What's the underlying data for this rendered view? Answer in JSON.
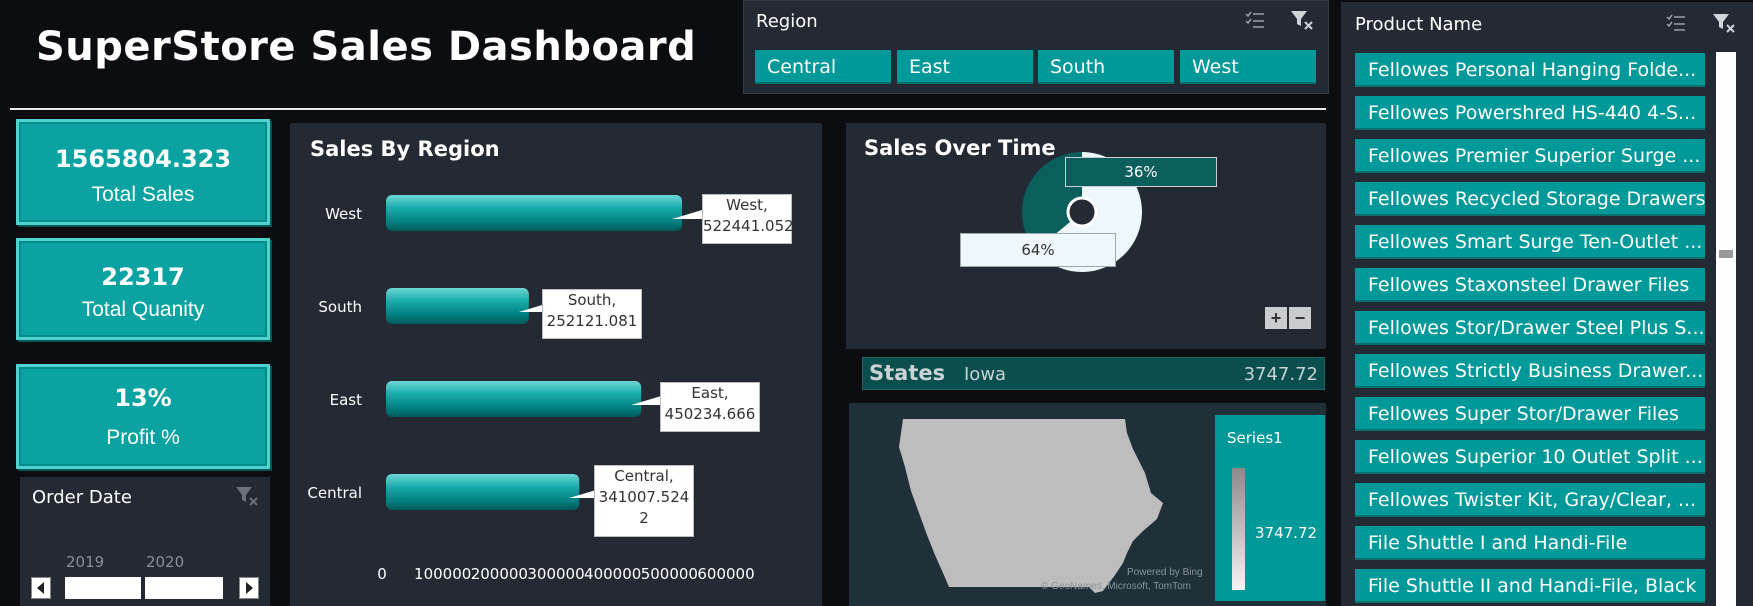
{
  "header": {
    "title": "SuperStore Sales Dashboard"
  },
  "region_slicer": {
    "title": "Region",
    "items": [
      "Central",
      "East",
      "South",
      "West"
    ]
  },
  "product_slicer": {
    "title": "Product Name",
    "items": [
      "Fellowes Personal Hanging Folde...",
      "Fellowes Powershred HS-440 4-S...",
      "Fellowes Premier Superior Surge ...",
      "Fellowes Recycled Storage Drawers",
      "Fellowes Smart Surge Ten-Outlet ...",
      "Fellowes Staxonsteel Drawer Files",
      "Fellowes Stor/Drawer Steel Plus S...",
      "Fellowes Strictly Business Drawer...",
      "Fellowes Super Stor/Drawer Files",
      "Fellowes Superior 10 Outlet Split ...",
      "Fellowes Twister Kit, Gray/Clear, ...",
      "File Shuttle I and Handi-File",
      "File Shuttle II and Handi-File, Black"
    ]
  },
  "kpis": {
    "total_sales": {
      "value": "1565804.323",
      "label": "Total Sales"
    },
    "total_quantity": {
      "value": "22317",
      "label": "Total Quanity"
    },
    "profit": {
      "value": "13%",
      "label": "Profit %"
    }
  },
  "order_date": {
    "title": "Order Date",
    "years": [
      "2019",
      "2020"
    ]
  },
  "sales_by_region": {
    "title": "Sales By Region",
    "callouts": {
      "west": [
        "West,",
        "522441.052"
      ],
      "south": [
        "South,",
        "252121.081"
      ],
      "east": [
        "East,",
        "450234.666"
      ],
      "central": [
        "Central,",
        "341007.524",
        "2"
      ]
    }
  },
  "sales_over_time": {
    "title": "Sales Over Time",
    "label_36": "36%",
    "label_64": "64%",
    "plus": "+",
    "minus": "−"
  },
  "states_bar": {
    "label": "States",
    "state": "Iowa",
    "value": "3747.72"
  },
  "map": {
    "legend_title": "Series1",
    "legend_value": "3747.72",
    "attribution_1": "Powered by Bing",
    "attribution_2": "© GeoNames, Microsoft, TomTom"
  },
  "colors": {
    "teal": "#00999a",
    "dark_teal": "#0a5e5c",
    "panel": "#242a33",
    "bg": "#0b0d10"
  },
  "chart_data": [
    {
      "type": "bar",
      "title": "Sales By Region",
      "categories": [
        "West",
        "South",
        "East",
        "Central"
      ],
      "values": [
        522441.052,
        252121.081,
        450234.666,
        341007.5242
      ],
      "xlim": [
        0,
        600000
      ],
      "xticks": [
        "0",
        "100000",
        "200000",
        "300000",
        "400000",
        "500000",
        "600000"
      ],
      "grid": false
    },
    {
      "type": "pie",
      "title": "Sales Over Time",
      "labels": [
        "36%",
        "64%"
      ],
      "values": [
        36,
        64
      ]
    }
  ]
}
